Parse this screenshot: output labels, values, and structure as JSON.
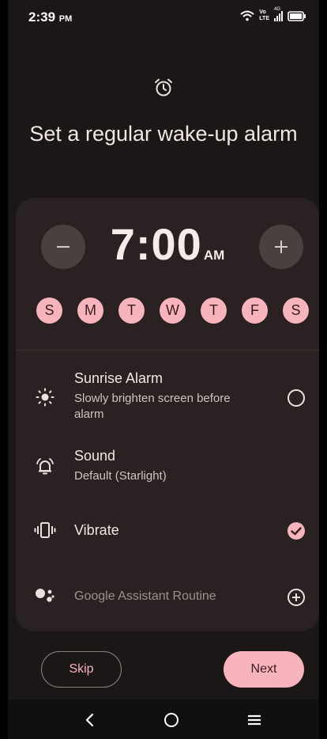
{
  "status_bar": {
    "time": "2:39",
    "ampm": "PM",
    "network_label_top": "Vo",
    "network_label_bottom": "LTE",
    "signal_label": "4G",
    "icons": [
      "wifi-icon",
      "volte-icon",
      "signal-icon",
      "battery-icon"
    ]
  },
  "header": {
    "icon": "alarm-clock-icon",
    "title": "Set a regular wake-up alarm"
  },
  "time_picker": {
    "time": "7:00",
    "ampm": "AM",
    "decrement_icon": "minus-icon",
    "increment_icon": "plus-icon"
  },
  "days": [
    {
      "label": "S",
      "selected": true
    },
    {
      "label": "M",
      "selected": true
    },
    {
      "label": "T",
      "selected": true
    },
    {
      "label": "W",
      "selected": true
    },
    {
      "label": "T",
      "selected": true
    },
    {
      "label": "F",
      "selected": true
    },
    {
      "label": "S",
      "selected": true
    }
  ],
  "options": {
    "sunrise": {
      "title": "Sunrise Alarm",
      "subtitle": "Slowly brighten screen before alarm",
      "icon": "brightness-icon",
      "checked": false
    },
    "sound": {
      "title": "Sound",
      "subtitle": "Default (Starlight)",
      "icon": "bell-ringing-icon"
    },
    "vibrate": {
      "title": "Vibrate",
      "icon": "vibrate-icon",
      "checked": true
    },
    "assistant": {
      "title": "Google Assistant Routine",
      "icon": "google-assistant-icon",
      "action_icon": "add-circle-icon"
    }
  },
  "footer": {
    "skip_label": "Skip",
    "next_label": "Next"
  },
  "nav_bar": {
    "icons": [
      "back-icon",
      "home-icon",
      "menu-icon"
    ]
  },
  "colors": {
    "background": "#1c1717",
    "card": "#2a2222",
    "accent_pink": "#f7b4bd",
    "button_gray": "#4a4040"
  }
}
